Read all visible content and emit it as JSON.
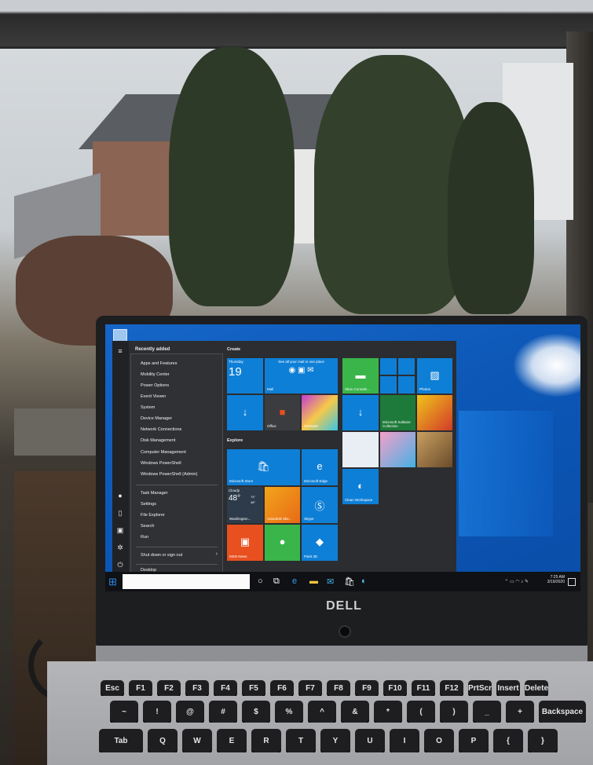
{
  "start_menu": {
    "recently_added_label": "Recently added",
    "context_items": [
      "Apps and Features",
      "Mobility Center",
      "Power Options",
      "Event Viewer",
      "System",
      "Device Manager",
      "Network Connections",
      "Disk Management",
      "Computer Management",
      "Windows PowerShell",
      "Windows PowerShell (Admin)",
      "Task Manager",
      "Settings",
      "File Explorer",
      "Search",
      "Run",
      "Shut down or sign out",
      "Desktop"
    ],
    "groups": {
      "create": "Create",
      "explore": "Explore"
    },
    "tiles": {
      "calendar_day": "Thursday",
      "calendar_date": "19",
      "mail_header": "See all your mail in one place",
      "mail_label": "Mail",
      "office_label": "Office",
      "onenote_label": "OneNote",
      "xbox_label": "Xbox Console...",
      "photos_label": "Photos",
      "solitaire_label": "Microsoft Solitaire Collection",
      "store_label": "Microsoft Store",
      "edge_label": "Microsoft Edge",
      "weather_condition": "Cloudy",
      "weather_temp": "48°",
      "weather_high": "74°",
      "weather_low": "48°",
      "weather_city": "Washington...",
      "sketch_label": "Autodesk Ske...",
      "skype_label": "Skype",
      "paint3d_label": "Paint 3D",
      "msn_label": "MSN News",
      "whiteboard_label": "Clean Workspace"
    }
  },
  "taskbar": {
    "time": "7:25 AM",
    "date": "3/19/2020"
  },
  "laptop": {
    "brand": "DELL"
  },
  "keyboard": {
    "row1": [
      "Esc",
      "F1",
      "F2",
      "F3",
      "F4",
      "F5",
      "F6",
      "F7",
      "F8",
      "F9",
      "F10",
      "F11",
      "F12",
      "PrtScr",
      "Insert",
      "Delete"
    ],
    "row2": [
      "~",
      "!",
      "@",
      "#",
      "$",
      "%",
      "^",
      "&",
      "*",
      "(",
      ")",
      "_",
      "+",
      "Backspace"
    ],
    "row3": [
      "Tab",
      "Q",
      "W",
      "E",
      "R",
      "T",
      "Y",
      "U",
      "I",
      "O",
      "P",
      "{",
      "}"
    ]
  }
}
